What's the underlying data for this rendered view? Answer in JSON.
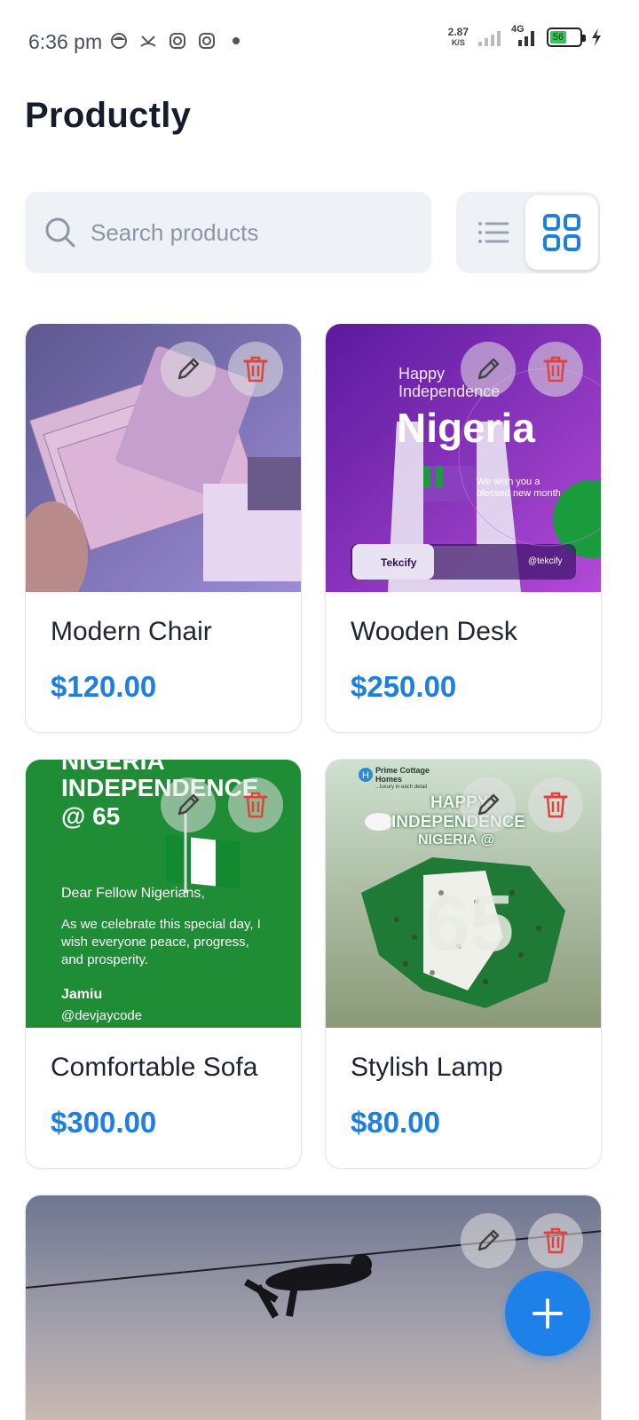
{
  "status_bar": {
    "time": "6:36 pm",
    "net_speed_value": "2.87",
    "net_speed_unit": "K/S",
    "network_type": "4G",
    "battery_level": "56"
  },
  "app": {
    "title": "Productly"
  },
  "search": {
    "placeholder": "Search products",
    "value": ""
  },
  "view_mode": {
    "selected": "grid",
    "options": [
      "list",
      "grid"
    ]
  },
  "colors": {
    "accent": "#1d7fe0",
    "delete": "#e0433a",
    "search_bg": "#eef1f6"
  },
  "products": [
    {
      "name": "Modern Chair",
      "price": "$120.00",
      "image": "banknotes-photo"
    },
    {
      "name": "Wooden Desk",
      "price": "$250.00",
      "image": "independence-flyer",
      "image_text": {
        "line1": "Happy",
        "line2": "Independence",
        "headline": "Nigeria",
        "wish": "We wish you a blessed new month",
        "brand": "Tekcify",
        "handle": "@tekcify"
      }
    },
    {
      "name": "Comfortable Sofa",
      "price": "$300.00",
      "image": "green-greeting",
      "image_text": {
        "headline1": "NIGERIA",
        "headline2": "INDEPENDENCE",
        "headline3": "@ 65",
        "greeting": "Dear Fellow Nigerians,",
        "message": "As we celebrate this special day, I wish everyone peace, progress, and prosperity.",
        "signature": "Jamiu",
        "handle": "@devjaycode"
      }
    },
    {
      "name": "Stylish Lamp",
      "price": "$80.00",
      "image": "crowd-map",
      "image_text": {
        "brand": "Prime Cottage Homes",
        "tagline": "...luxury in each detail",
        "headline1": "HAPPY",
        "headline2": "INDEPENDENCE",
        "headline3": "NIGERIA @",
        "number": "65"
      }
    },
    {
      "name": "",
      "price": "",
      "image": "tightrope-sky"
    }
  ],
  "icons": {
    "edit": "pencil-icon",
    "delete": "trash-icon",
    "search": "search-icon",
    "list": "list-view-icon",
    "grid": "grid-view-icon",
    "add": "plus-icon"
  }
}
